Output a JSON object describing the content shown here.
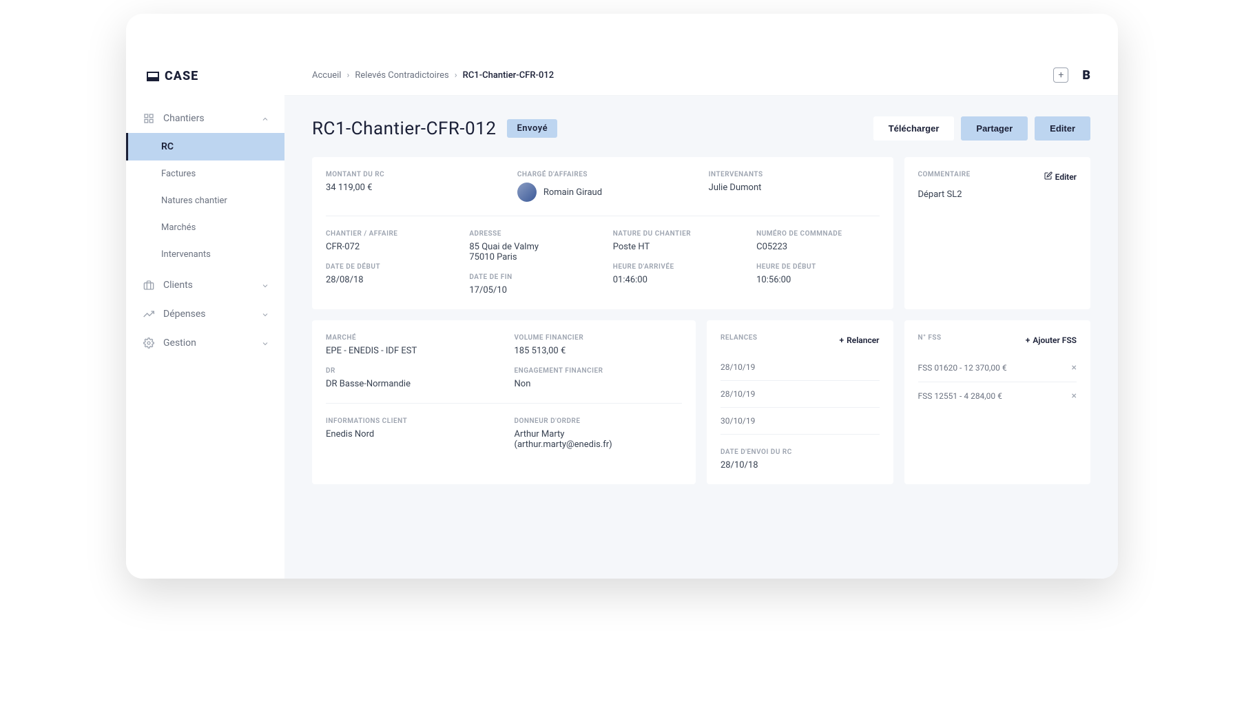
{
  "logo": "CASE",
  "sidebar": {
    "chantiers": {
      "label": "Chantiers",
      "items": [
        {
          "label": "RC"
        },
        {
          "label": "Factures"
        },
        {
          "label": "Natures chantier"
        },
        {
          "label": "Marchés"
        },
        {
          "label": "Intervenants"
        }
      ]
    },
    "clients": "Clients",
    "depenses": "Dépenses",
    "gestion": "Gestion"
  },
  "breadcrumbs": {
    "home": "Accueil",
    "section": "Relevés Contradictoires",
    "current": "RC1-Chantier-CFR-012"
  },
  "brand": "B",
  "pageTitle": "RC1-Chantier-CFR-012",
  "status": "Envoyé",
  "actions": {
    "download": "Télécharger",
    "share": "Partager",
    "edit": "Editer"
  },
  "summary": {
    "montantLabel": "MONTANT DU RC",
    "montantValue": "34 119,00 €",
    "chargeLabel": "CHARGÉ D'AFFAIRES",
    "chargeName": "Romain Giraud",
    "intervenantsLabel": "INTERVENANTS",
    "intervenantsValue": "Julie Dumont"
  },
  "details": {
    "chantierLabel": "CHANTIER / AFFAIRE",
    "chantierValue": "CFR-072",
    "dateDebutLabel": "DATE DE DÉBUT",
    "dateDebutValue": "28/08/18",
    "adresseLabel": "ADRESSE",
    "adresseValue1": "85 Quai de Valmy",
    "adresseValue2": "75010 Paris",
    "dateFinLabel": "DATE DE FIN",
    "dateFinValue": "17/05/10",
    "natureLabel": "NATURE DU CHANTIER",
    "natureValue": "Poste HT",
    "heureArriveeLabel": "HEURE D'ARRIVÉE",
    "heureArriveeValue": "01:46:00",
    "numeroLabel": "NUMÉRO DE COMMNADE",
    "numeroValue": "C05223",
    "heureDebutLabel": "HEURE DE DÉBUT",
    "heureDebutValue": "10:56:00"
  },
  "comment": {
    "label": "COMMENTAIRE",
    "editLabel": "Editer",
    "value": "Départ SL2"
  },
  "market": {
    "marcheLabel": "MARCHÉ",
    "marcheValue": "EPE - ENEDIS - IDF EST",
    "volumeLabel": "VOLUME FINANCIER",
    "volumeValue": "185 513,00 €",
    "drLabel": "DR",
    "drValue": "DR Basse-Normandie",
    "engagementLabel": "ENGAGEMENT FINANCIER",
    "engagementValue": "Non",
    "clientInfoLabel": "INFORMATIONS CLIENT",
    "clientInfoValue": "Enedis Nord",
    "donneurLabel": "DONNEUR D'ORDRE",
    "donneurName": "Arthur Marty",
    "donneurEmail": "(arthur.marty@enedis.fr)"
  },
  "relances": {
    "label": "RELANCES",
    "actionLabel": "Relancer",
    "items": [
      "28/10/19",
      "28/10/19",
      "30/10/19"
    ],
    "sendDateLabel": "DATE D'ENVOI DU RC",
    "sendDateValue": "28/10/18"
  },
  "fss": {
    "label": "N° FSS",
    "actionLabel": "Ajouter FSS",
    "items": [
      "FSS 01620 - 12 370,00 €",
      "FSS 12551 - 4 284,00 €"
    ]
  }
}
